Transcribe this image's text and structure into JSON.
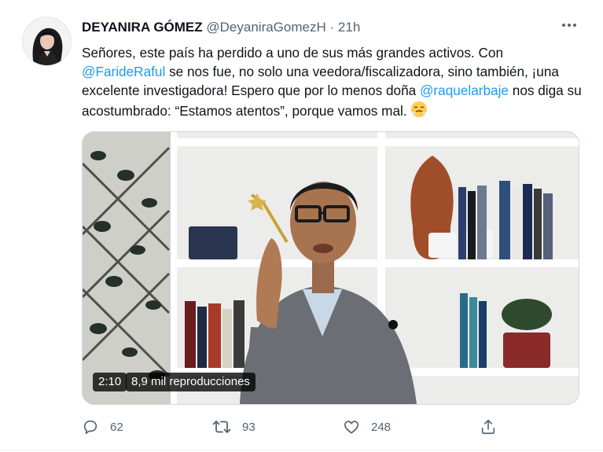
{
  "tweet": {
    "author_name": "DEYANIRA GÓMEZ",
    "handle": "@DeyaniraGomezH",
    "separator": "·",
    "time": "21h",
    "text_parts": {
      "p1": "Señores, este país ha perdido a uno de sus más grandes activos. Con ",
      "m1": "@FarideRaful",
      "p2": " se nos fue, no solo una veedora/fiscalizadora, sino también, ¡una excelente investigadora! Espero que por lo menos doña ",
      "m2": "@raquelarbaje",
      "p3": " nos diga su acostumbrado: “Estamos atentos”, porque vamos mal. "
    },
    "emoji": "face-with-steam-from-nose"
  },
  "video": {
    "duration": "2:10",
    "views": "8,9 mil reproducciones"
  },
  "actions": {
    "reply_count": "62",
    "retweet_count": "93",
    "like_count": "248"
  },
  "colors": {
    "mention": "#1d9bf0",
    "secondary_text": "#536471",
    "primary_text": "#0f1419"
  },
  "icons": [
    "more-icon",
    "reply-icon",
    "retweet-icon",
    "like-icon",
    "share-icon"
  ]
}
